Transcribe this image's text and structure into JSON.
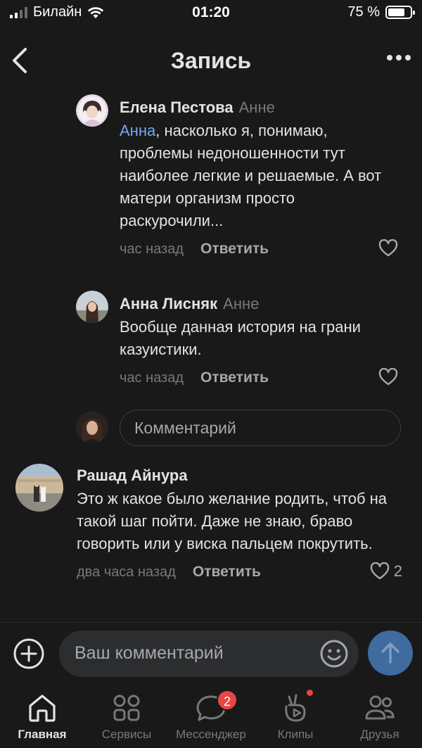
{
  "status_bar": {
    "carrier": "Билайн",
    "time": "01:20",
    "battery_percent": "75 %",
    "battery_level": 0.75
  },
  "header": {
    "title": "Запись",
    "back_icon": "chevron-left-icon",
    "more_icon": "more-horizontal-icon"
  },
  "comments": [
    {
      "author": "Елена Пестова",
      "reply_to": "Анне",
      "mention": "Анна",
      "text": ", насколько я, понимаю, проблемы недоношенности тут наиболее легкие и решаемые. А вот матери организм просто раскурочили...",
      "time": "час назад",
      "reply_label": "Ответить",
      "likes": ""
    },
    {
      "author": "Анна Лисняк",
      "reply_to": "Анне",
      "mention": "",
      "text": "Вообще данная история на грани казуистики.",
      "time": "час назад",
      "reply_label": "Ответить",
      "likes": ""
    },
    {
      "author": "Рашад Айнура",
      "reply_to": "",
      "mention": "",
      "text": "Это ж какое было желание родить, чтоб на такой шаг пойти. Даже не знаю, браво говорить или у виска пальцем покрутить.",
      "time": "два часа назад",
      "reply_label": "Ответить",
      "likes": "2"
    }
  ],
  "reply_box": {
    "placeholder": "Комментарий"
  },
  "composer": {
    "placeholder": "Ваш комментарий"
  },
  "tabs": [
    {
      "label": "Главная",
      "icon": "home-icon",
      "active": true
    },
    {
      "label": "Сервисы",
      "icon": "services-icon",
      "active": false
    },
    {
      "label": "Мессенджер",
      "icon": "messenger-icon",
      "active": false,
      "badge": "2"
    },
    {
      "label": "Клипы",
      "icon": "clips-icon",
      "active": false
    },
    {
      "label": "Друзья",
      "icon": "friends-icon",
      "active": false
    }
  ],
  "colors": {
    "background": "#19191a",
    "text": "#e1e3e6",
    "secondary": "#76787a",
    "link": "#71aaeb",
    "badge": "#e64646",
    "send_button": "#3f6b9e"
  }
}
